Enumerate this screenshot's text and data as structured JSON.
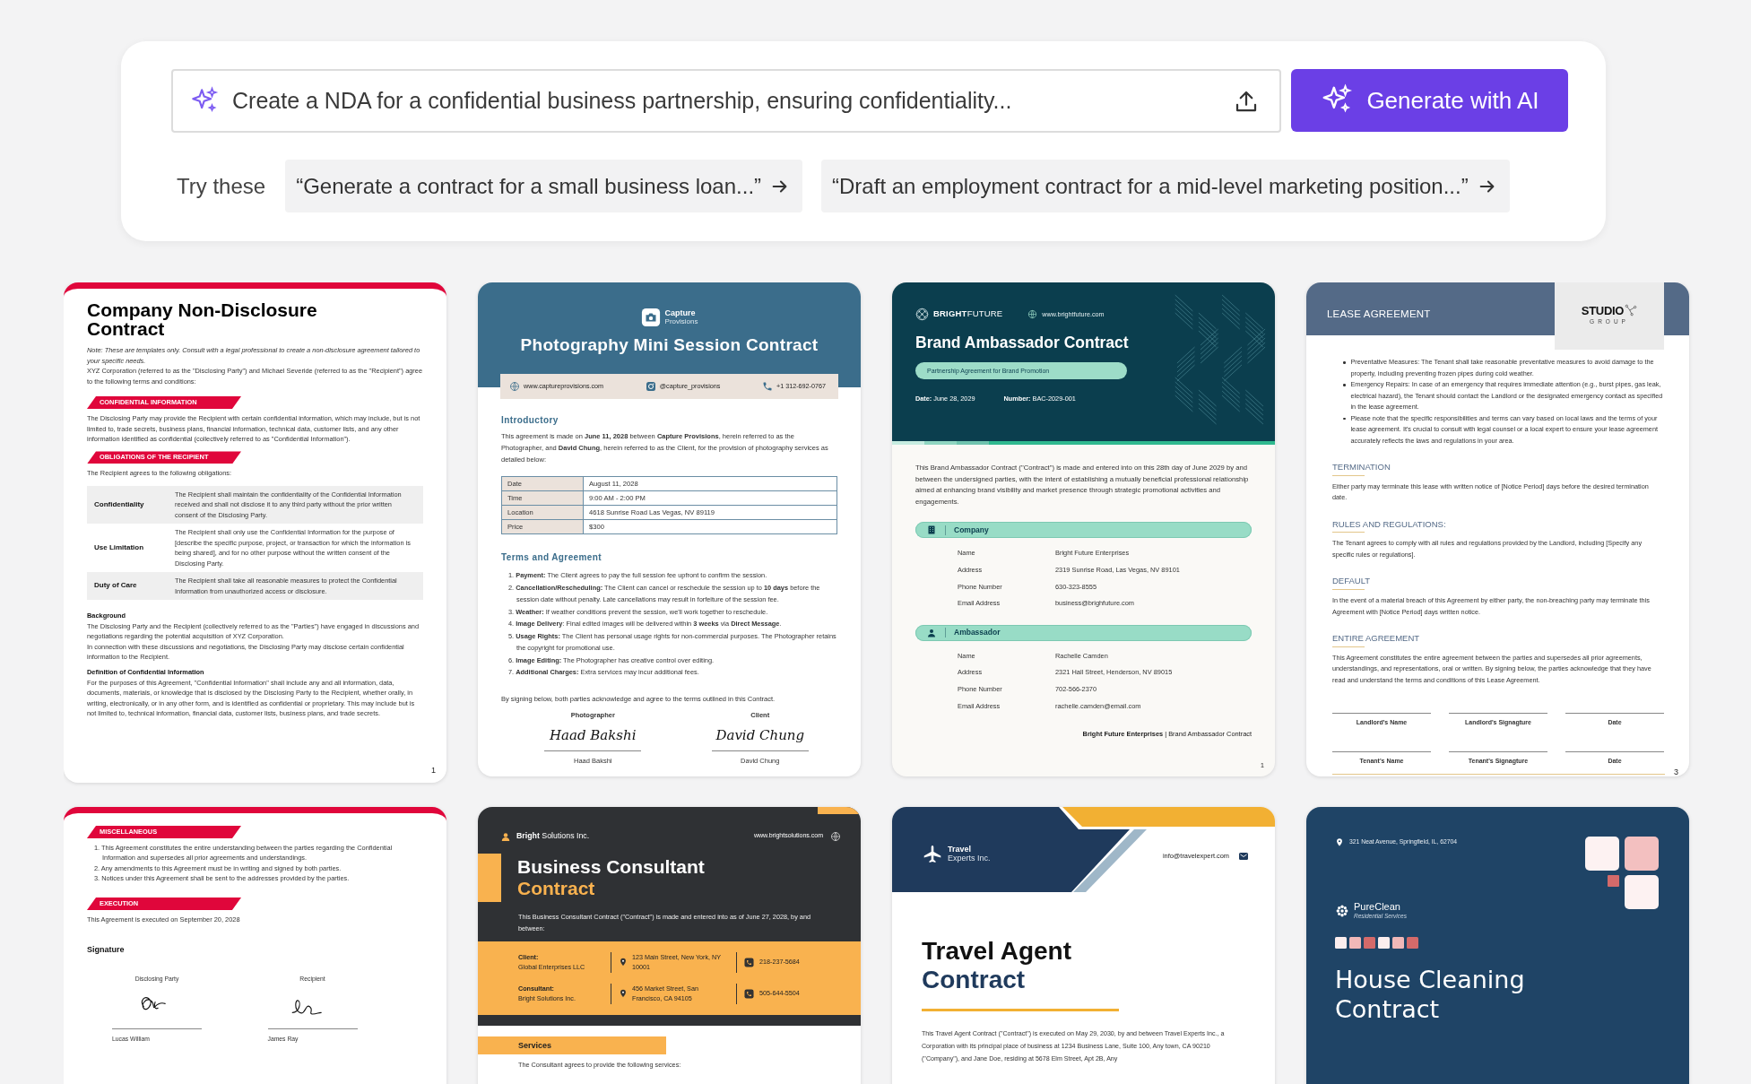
{
  "prompt": {
    "placeholder": "Create a NDA for a confidential business partnership, ensuring confidentiality...",
    "button": "Generate with AI"
  },
  "suggestions": {
    "label": "Try these",
    "items": [
      "“Generate a contract for a small business loan...”",
      "“Draft an employment contract for a mid-level marketing position...”"
    ]
  },
  "templates": [
    {
      "kind": "nda",
      "page": "1",
      "blocks": [
        {
          "kind": "title",
          "text": "Company Non-Disclosure Contract"
        },
        {
          "kind": "note",
          "text": "Note: These are templates only. Consult with a legal professional to create a non-disclosure agreement tailored to your specific needs."
        },
        {
          "kind": "para",
          "text": "XYZ Corporation  (referred to as the \"Disclosing Party\") and Michael Severide (referred to as the \"Recipient\") agree to the following terms and conditions:"
        },
        {
          "kind": "ribbon",
          "text": "CONFIDENTIAL INFORMATION"
        },
        {
          "kind": "para",
          "text": "The Disclosing Party may provide the Recipient with certain confidential information, which may include, but is not limited to, trade secrets, business plans, financial information, technical data, customer lists, and any other information identified as confidential (collectively referred to as \"Confidential Information\")."
        },
        {
          "kind": "ribbon",
          "text": "OBLIGATIONS OF THE RECIPIENT"
        },
        {
          "kind": "para",
          "text": "The Recipient agrees to the following obligations:"
        },
        {
          "kind": "terms",
          "rows": [
            {
              "term": "Confidentiality",
              "text": "The Recipient shall maintain the confidentiality of the Confidential Information received and shall not disclose it to any third party without the prior written consent of the Disclosing Party."
            },
            {
              "term": "Use Limitation",
              "text": "The Recipient shall only use the Confidential Information for the purpose of [describe the specific purpose, project, or transaction for which the information is being shared], and for no other purpose without the written consent of the Disclosing Party."
            },
            {
              "term": "Duty of Care",
              "text": "The Recipient shall take all reasonable measures to protect the Confidential Information from unauthorized access or disclosure."
            }
          ]
        },
        {
          "kind": "subheading",
          "text": "Background"
        },
        {
          "kind": "para",
          "text": "The Disclosing Party and the Recipient (collectively referred to as the \"Parties\") have engaged in discussions and negotiations regarding the potential acquisition of XYZ Corporation."
        },
        {
          "kind": "para",
          "text": "In connection with these discussions and negotiations, the Disclosing Party may disclose certain confidential information to the Recipient."
        },
        {
          "kind": "subheading",
          "text": "Definition of Confidential Information"
        },
        {
          "kind": "para",
          "text": "For the purposes of this Agreement, \"Confidential Information\" shall include any and all information, data, documents, materials, or knowledge that is disclosed by the Disclosing Party to the Recipient, whether orally, in writing, electronically, or in any other form, and is identified as confidential or proprietary. This may include but is not limited to, technical information, financial data, customer lists, business plans, and trade secrets."
        }
      ]
    },
    {
      "kind": "photo",
      "logo_top": "Capture",
      "logo_bottom": "Provisions",
      "title": "Photography Mini Session Contract",
      "contacts": [
        {
          "text": "www.captureprovisions.com"
        },
        {
          "text": "@capture_provisions"
        },
        {
          "text": "+1 312-692-0767"
        }
      ],
      "blocks": [
        {
          "kind": "heading",
          "text": "Introductory"
        },
        {
          "kind": "para",
          "text": "This agreement is made on **June 11, 2028** between **Capture Provisions**, herein referred to as the Photographer, and **David Chung**, herein referred to as the Client, for the provision of photography services as detailed below:"
        },
        {
          "kind": "kvtable",
          "rows": [
            [
              "Date",
              "August 11, 2028"
            ],
            [
              "Time",
              "9:00 AM - 2:00 PM"
            ],
            [
              "Location",
              "4618 Sunrise Road Las Vegas, NV 89119"
            ],
            [
              "Price",
              "$300"
            ]
          ]
        },
        {
          "kind": "heading",
          "text": "Terms and Agreement"
        },
        {
          "kind": "list",
          "items": [
            "1. **Payment:** The Client agrees to pay the full session fee upfront to confirm the session.",
            "2. **Cancellation/Rescheduling:** The Client can cancel or reschedule the session up to **10 days** before the session date without penalty. Late cancellations may result in forfeiture of the session fee.",
            "3. **Weather:** If weather conditions prevent the session, we'll work together to reschedule.",
            "4. **Image Delivery**: Final edited images will be delivered within **3 weeks** via **Direct Message**.",
            "5. **Usage Rights:** The Client has personal usage rights for non-commercial purposes. The Photographer retains the copyright for promotional use.",
            "6. **Image Editing:** The Photographer has creative control over editing.",
            "7. **Additional Charges:** Extra services may incur additional fees."
          ]
        },
        {
          "kind": "para",
          "text": "By signing below, both parties acknowledge and agree to the terms outlined in this Contract."
        },
        {
          "kind": "signatures",
          "items": [
            {
              "role": "Photographer",
              "signature": "Haad Bakshi",
              "name": "Haad Bakshi"
            },
            {
              "role": "Client",
              "signature": "David Chung",
              "name": "David Chung"
            }
          ]
        }
      ]
    },
    {
      "kind": "brand",
      "page": "1",
      "brand": "**BRIGHT**FUTURE",
      "website": "www.brightfuture.com",
      "title": "Brand Ambassador Contract",
      "tagline": "Partnership Agreement for Brand Promotion",
      "meta": [
        "**Date:** June 28, 2029",
        "**Number:** BAC-2029-001"
      ],
      "blocks": [
        {
          "kind": "para",
          "text": "This Brand Ambassador Contract (\"Contract\") is made and entered into on this 28th day of June 2029 by and between the undersigned parties, with the intent of establishing a mutually beneficial professional relationship aimed at enhancing brand visibility and market presence through strategic promotional activities and engagements."
        },
        {
          "kind": "infosection",
          "label": "Company",
          "rows": [
            [
              "Name",
              "Bright Future Enterprises"
            ],
            [
              "Address",
              "2319 Sunrise Road, Las Vegas, NV 89101"
            ],
            [
              "Phone Number",
              "630-323-8555"
            ],
            [
              "Email Address",
              "business@brighfuture.com"
            ]
          ]
        },
        {
          "kind": "infosection",
          "label": "Ambassador",
          "rows": [
            [
              "Name",
              "Rachelle Camden"
            ],
            [
              "Address",
              "2321 Hall Street, Henderson, NV 89015"
            ],
            [
              "Phone Number",
              "702-566-2370"
            ],
            [
              "Email Address",
              "rachelle.camden@email.com"
            ]
          ]
        },
        {
          "kind": "footer",
          "text": "**Bright Future Enterprises** | Brand Ambassador Contract"
        }
      ]
    },
    {
      "kind": "lease",
      "page": "3",
      "title": "LEASE AGREEMENT",
      "logo_top": "STUDIO",
      "logo_bottom": "GROUP",
      "blocks": [
        {
          "kind": "bullets",
          "items": [
            "Preventative Measures: The Tenant shall take reasonable preventative measures to avoid damage to the property, including preventing frozen pipes during cold weather.",
            "Emergency Repairs: In case of an emergency that requires immediate attention (e.g., burst pipes, gas leak, electrical hazard), the Tenant should contact the Landlord or the designated emergency contact as specified in the lease agreement.",
            "Please note that the specific responsibilities and terms can vary based on local laws and the terms of your lease agreement. It's crucial to consult with legal counsel or a local expert to ensure your lease agreement accurately reflects the laws and regulations in your area."
          ]
        },
        {
          "kind": "heading",
          "text": "TERMINATION"
        },
        {
          "kind": "para",
          "text": "Either party may terminate this lease with written notice of [Notice Period] days before the desired termination date."
        },
        {
          "kind": "heading",
          "text": "RULES AND REGULATIONS:"
        },
        {
          "kind": "para",
          "text": "The Tenant agrees to comply with all rules and regulations provided by the Landlord, including [Specify any specific rules or regulations]."
        },
        {
          "kind": "heading",
          "text": "DEFAULT"
        },
        {
          "kind": "para",
          "text": "In the event of a material breach of this Agreement by either party, the non-breaching party may terminate this Agreement with [Notice Period] days written notice."
        },
        {
          "kind": "heading",
          "text": "ENTIRE AGREEMENT"
        },
        {
          "kind": "para",
          "text": "This Agreement constitutes the entire agreement between the parties and supersedes all prior agreements, understandings, and representations, oral or written. By signing below, the parties acknowledge that they have read and understand the terms and conditions of this Lease Agreement."
        },
        {
          "kind": "signlines",
          "items": [
            "Landlord's Name",
            "Landlord's Signagture",
            "Date",
            "Tenant's Name",
            "Tenant's Signagture",
            "Date"
          ]
        }
      ]
    },
    {
      "kind": "nda",
      "blocks": [
        {
          "kind": "ribbon",
          "text": "MISCELLANEOUS"
        },
        {
          "kind": "list",
          "items": [
            "1. This Agreement constitutes the entire understanding between the parties regarding the Confidential Information and supersedes all prior agreements and understandings.",
            "2. Any amendments to this Agreement must be in writing and signed by both parties.",
            "3. Notices under this Agreement shall be sent to the addresses provided by the parties."
          ]
        },
        {
          "kind": "ribbon",
          "text": "EXECUTION"
        },
        {
          "kind": "para",
          "text": "This Agreement is executed on September 20, 2028"
        },
        {
          "kind": "subheading",
          "text": "Signature"
        },
        {
          "kind": "signatures",
          "items": [
            {
              "role": "Disclosing Party",
              "name": "Lucas William"
            },
            {
              "role": "Recipient",
              "name": "James Ray"
            }
          ]
        }
      ]
    },
    {
      "kind": "consultant",
      "company": "**Bright** Solutions Inc.",
      "website": "www.brightsolutions.com",
      "title": [
        "Business Consultant",
        "Contract"
      ],
      "intro": "This Business Consultant Contract (\"Contract\") is made and entered into as of June 27, 2028, by and between:",
      "parties": [
        {
          "role": "Client:",
          "name": "Global Enterprises LLC",
          "address": "123 Main Street, New York, NY 10001",
          "phone": "218-237-5684"
        },
        {
          "role": "Consultant:",
          "name": "Bright Solutions Inc.",
          "address": "456 Market Street, San Francisco, CA 94105",
          "phone": "505-644-5504"
        }
      ],
      "blocks": [
        {
          "kind": "barheading",
          "text": "Services"
        },
        {
          "kind": "para",
          "text": "The Consultant agrees to provide the following services:"
        }
      ]
    },
    {
      "kind": "travel",
      "logo_top": "Travel",
      "logo_bottom": "Experts Inc.",
      "email": "info@travelexpert.com",
      "title": [
        "Travel Agent",
        "Contract"
      ],
      "blocks": [
        {
          "kind": "para",
          "text": "This Travel Agent Contract (\"Contract\") is executed on May 29, 2030, by and between Travel Experts Inc., a Corporation with its principal place of business at 1234 Business Lane, Suite 100, Any town, CA 90210 (\"Company\"), and Jane Doe, residing at 5678 Elm Street, Apt 2B, Any"
        }
      ]
    },
    {
      "kind": "cleaning",
      "address": "321 Neat Avenue, Springfield, IL, 62704",
      "brand": "PureClean",
      "brand_sub": "Residential Services",
      "title": "House Cleaning Contract"
    }
  ]
}
